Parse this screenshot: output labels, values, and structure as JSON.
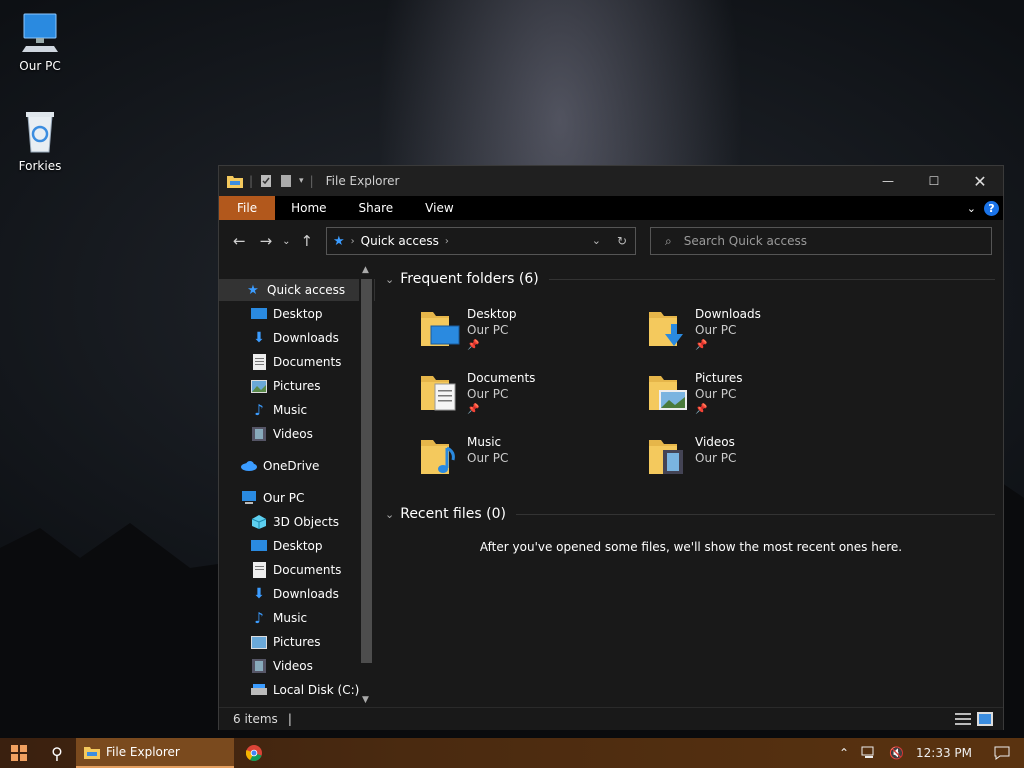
{
  "desktop": {
    "icons": [
      {
        "label": "Our PC"
      },
      {
        "label": "Forkies"
      }
    ]
  },
  "window": {
    "title": "File Explorer",
    "ribbon": {
      "tabs": [
        "File",
        "Home",
        "Share",
        "View"
      ],
      "help": "?"
    },
    "address": {
      "crumb": "Quick access"
    },
    "search": {
      "placeholder": "Search Quick access"
    },
    "sidebar": {
      "items": [
        {
          "label": "Quick access",
          "icon": "star-icon",
          "level": 0,
          "selected": true
        },
        {
          "label": "Desktop",
          "icon": "desktop-icon",
          "level": 1,
          "pinned": true
        },
        {
          "label": "Downloads",
          "icon": "download-icon",
          "level": 1,
          "pinned": true
        },
        {
          "label": "Documents",
          "icon": "document-icon",
          "level": 1,
          "pinned": true
        },
        {
          "label": "Pictures",
          "icon": "picture-icon",
          "level": 1,
          "pinned": true
        },
        {
          "label": "Music",
          "icon": "music-icon",
          "level": 1
        },
        {
          "label": "Videos",
          "icon": "video-icon",
          "level": 1
        },
        {
          "label": "OneDrive",
          "icon": "cloud-icon",
          "level": 0
        },
        {
          "label": "Our PC",
          "icon": "computer-icon",
          "level": 0
        },
        {
          "label": "3D Objects",
          "icon": "cube-icon",
          "level": 1
        },
        {
          "label": "Desktop",
          "icon": "desktop-icon",
          "level": 1
        },
        {
          "label": "Documents",
          "icon": "document-icon",
          "level": 1
        },
        {
          "label": "Downloads",
          "icon": "download-icon",
          "level": 1
        },
        {
          "label": "Music",
          "icon": "music-icon",
          "level": 1
        },
        {
          "label": "Pictures",
          "icon": "picture-icon",
          "level": 1
        },
        {
          "label": "Videos",
          "icon": "video-icon",
          "level": 1
        },
        {
          "label": "Local Disk (C:)",
          "icon": "disk-icon",
          "level": 1
        }
      ]
    },
    "frequent": {
      "heading": "Frequent folders (6)",
      "folders": [
        {
          "name": "Desktop",
          "location": "Our PC",
          "pinned": true,
          "icon": "desktop-folder-icon"
        },
        {
          "name": "Downloads",
          "location": "Our PC",
          "pinned": true,
          "icon": "downloads-folder-icon"
        },
        {
          "name": "Documents",
          "location": "Our PC",
          "pinned": true,
          "icon": "documents-folder-icon"
        },
        {
          "name": "Pictures",
          "location": "Our PC",
          "pinned": true,
          "icon": "pictures-folder-icon"
        },
        {
          "name": "Music",
          "location": "Our PC",
          "pinned": false,
          "icon": "music-folder-icon"
        },
        {
          "name": "Videos",
          "location": "Our PC",
          "pinned": false,
          "icon": "videos-folder-icon"
        }
      ]
    },
    "recent": {
      "heading": "Recent files (0)",
      "empty_text": "After you've opened some files, we'll show the most recent ones here."
    },
    "status": {
      "items": "6 items"
    }
  },
  "taskbar": {
    "apps": [
      {
        "label": "File Explorer"
      }
    ],
    "clock": "12:33 PM"
  },
  "colors": {
    "accent": "#b2581c",
    "help_blue": "#1a73e8",
    "folder_yellow": "#f4c95d"
  }
}
